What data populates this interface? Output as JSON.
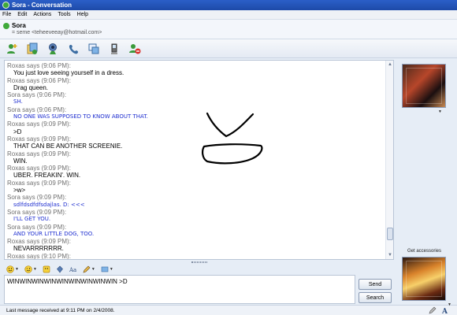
{
  "window": {
    "title": "Sora - Conversation"
  },
  "menu": [
    "File",
    "Edit",
    "Actions",
    "Tools",
    "Help"
  ],
  "contact": {
    "name": "Sora",
    "email": "= seme <teheeveeay@hotmail.com>"
  },
  "toolbar": {
    "icons": [
      "invite-contact-icon",
      "send-files-icon",
      "webcam-icon",
      "call-icon",
      "activities-icon",
      "games-icon",
      "block-icon"
    ]
  },
  "conversation": [
    {
      "who": "Roxas says (9:06 PM):",
      "text": "You just love seeing yourself in a dress.",
      "speaker": "roxas"
    },
    {
      "who": "Roxas says (9:06 PM):",
      "text": "Drag queen.",
      "speaker": "roxas"
    },
    {
      "who": "Sora says (9:06 PM):",
      "text": "SH.",
      "speaker": "sora"
    },
    {
      "who": "Sora says (9:06 PM):",
      "text": "NO ONE WAS SUPPOSED TO KNOW ABOUT THAT.",
      "speaker": "sora"
    },
    {
      "who": "Roxas says (9:09 PM):",
      "text": ">D",
      "speaker": "roxas"
    },
    {
      "who": "Roxas says (9:09 PM):",
      "text": "THAT CAN BE ANOTHER SCREENIE.",
      "speaker": "roxas"
    },
    {
      "who": "Roxas says (9:09 PM):",
      "text": "WIN.",
      "speaker": "roxas"
    },
    {
      "who": "Roxas says (9:09 PM):",
      "text": "UBER. FREAKIN'. WIN.",
      "speaker": "roxas"
    },
    {
      "who": "Roxas says (9:09 PM):",
      "text": ">w>",
      "speaker": "roxas"
    },
    {
      "who": "Sora says (9:09 PM):",
      "text": "sdlfdsdfdfsdajlas. D: <<<",
      "speaker": "sora"
    },
    {
      "who": "Sora says (9:09 PM):",
      "text": "I'LL GET YOU.",
      "speaker": "sora"
    },
    {
      "who": "Sora says (9:09 PM):",
      "text": "AND YOUR LITTLE DOG, TOO.",
      "speaker": "sora"
    },
    {
      "who": "Roxas says (9:09 PM):",
      "text": "NEVARRRRRRR.",
      "speaker": "roxas"
    },
    {
      "who": "Roxas says (9:10 PM):",
      "text": "",
      "speaker": "roxas"
    }
  ],
  "input": {
    "value": "WINWINWINWINWINWINWINWINWIN >D"
  },
  "buttons": {
    "send": "Send",
    "search": "Search"
  },
  "status": {
    "text": "Last message received at 9:11 PM on 2/4/2008."
  },
  "sidebar": {
    "accessories_label": "Get accessories"
  },
  "colors": {
    "sora_text": "#1f2fd0",
    "roxas_text": "#000000",
    "title_bar": "#2b5fc8"
  }
}
